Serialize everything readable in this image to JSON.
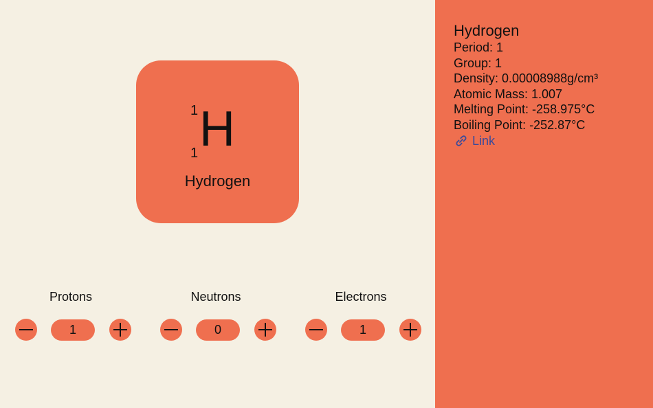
{
  "element": {
    "mass_number": "1",
    "atomic_number": "1",
    "symbol": "H",
    "name": "Hydrogen"
  },
  "counters": {
    "protons": {
      "label": "Protons",
      "value": "1"
    },
    "neutrons": {
      "label": "Neutrons",
      "value": "0"
    },
    "electrons": {
      "label": "Electrons",
      "value": "1"
    }
  },
  "details": {
    "title": "Hydrogen",
    "period": "Period: 1",
    "group": "Group: 1",
    "density": "Density: 0.00008988g/cm³",
    "atomic_mass": "Atomic Mass: 1.007",
    "melting_point": "Melting Point: -258.975°C",
    "boiling_point": "Boiling Point: -252.87°C",
    "link_label": "Link"
  },
  "icons": {
    "minus": "minus-icon",
    "plus": "plus-icon",
    "link": "link-icon"
  },
  "colors": {
    "background": "#f5f0e3",
    "accent": "#ef6f4f",
    "link": "#3a4a9b"
  }
}
